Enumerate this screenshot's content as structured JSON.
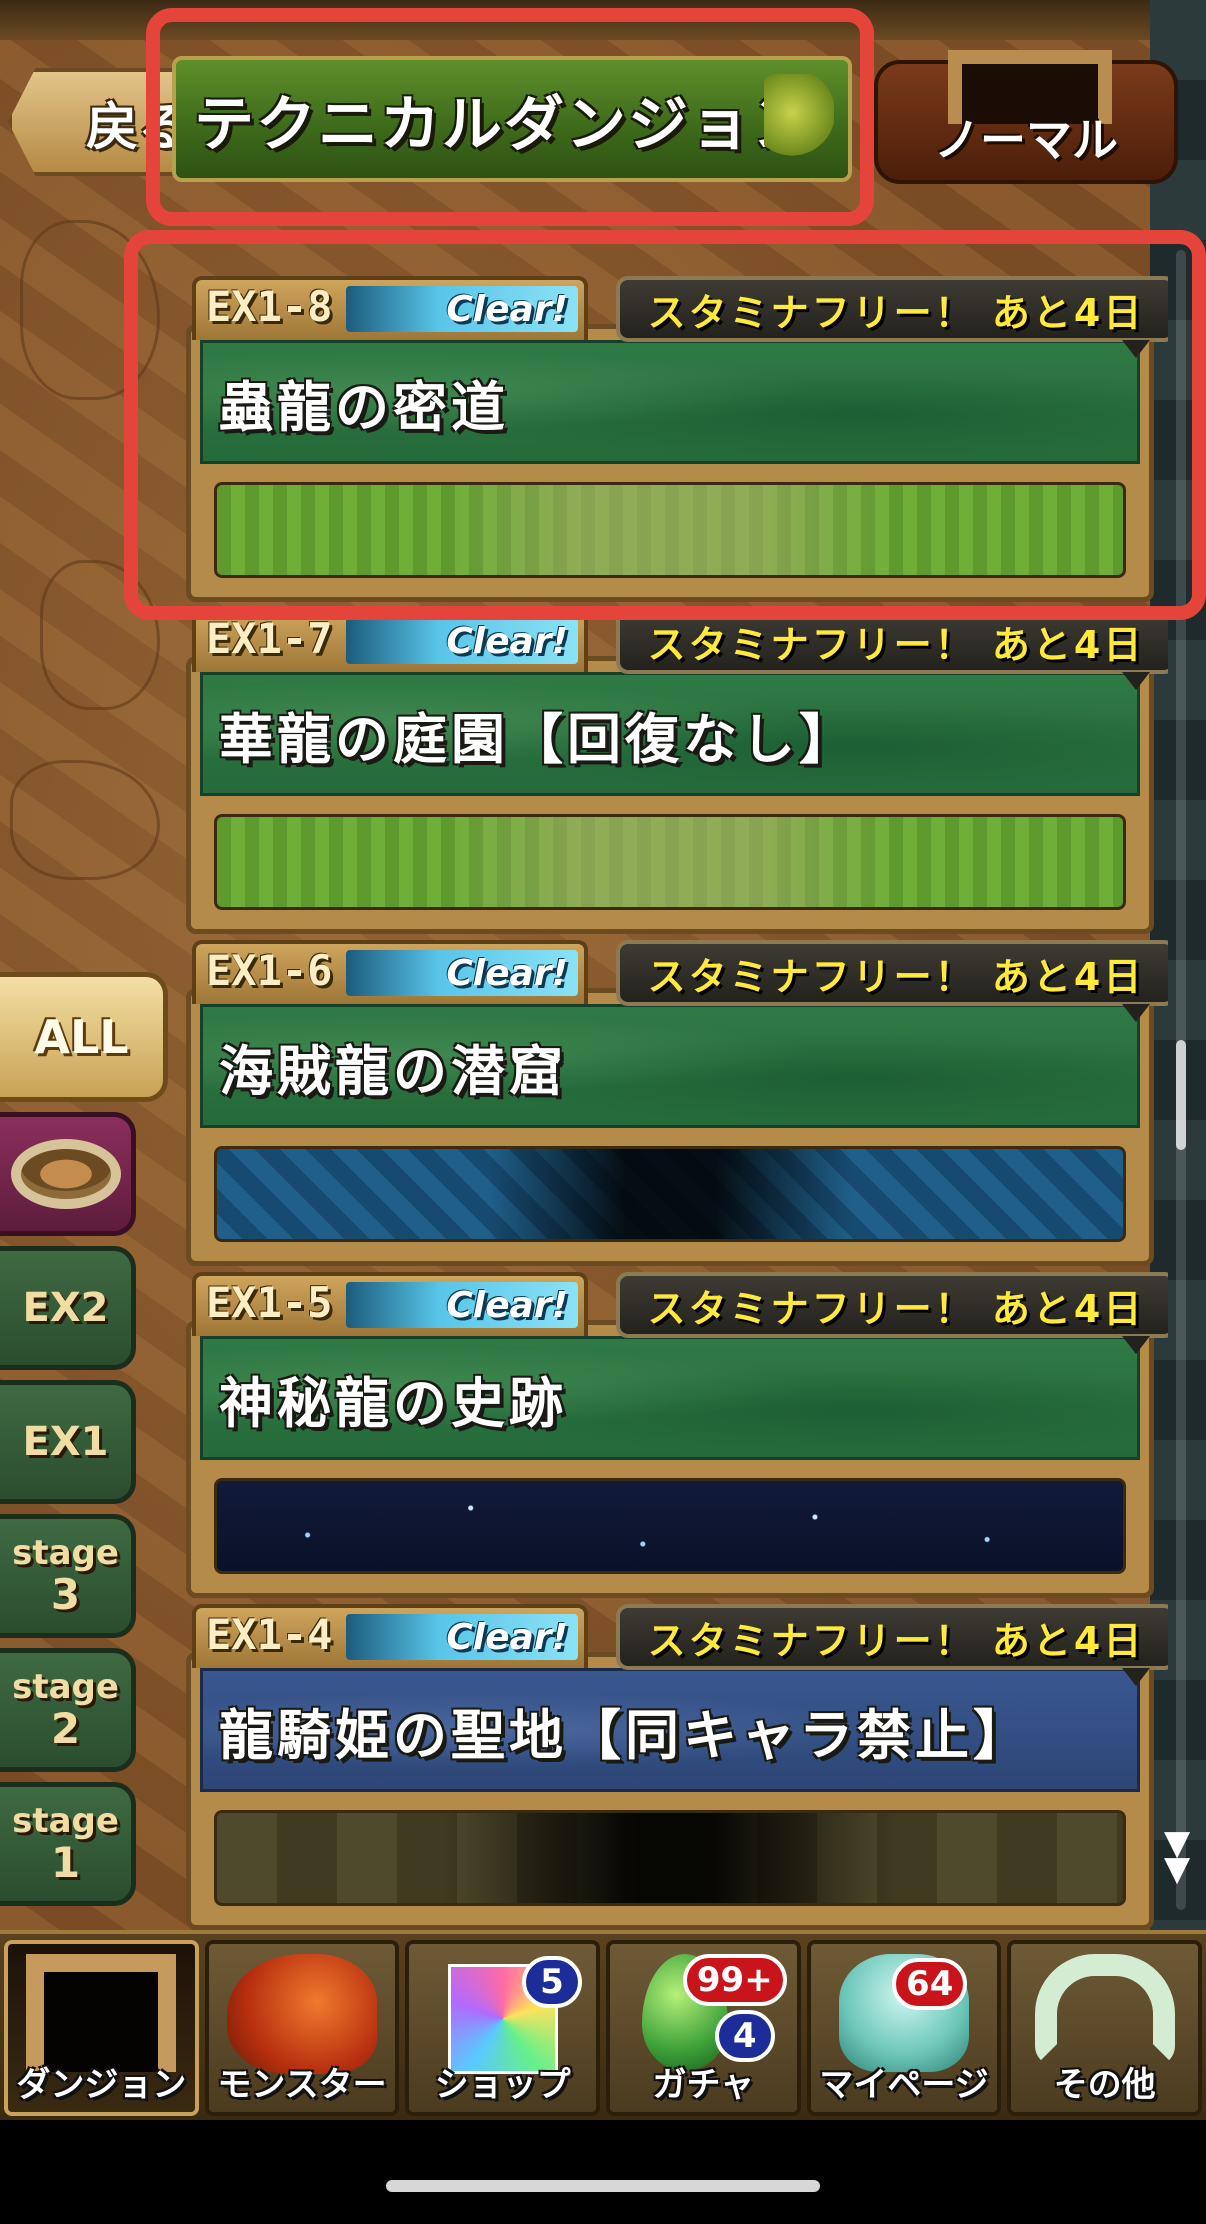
{
  "header": {
    "back_label": "戻る",
    "title": "テクニカルダンジョン",
    "difficulty": "ノーマル"
  },
  "side_filters": [
    {
      "label": "ALL",
      "kind": "all"
    },
    {
      "label": "",
      "kind": "arena"
    },
    {
      "label": "EX2",
      "kind": "plain"
    },
    {
      "label": "EX1",
      "kind": "plain"
    },
    {
      "label": "stage",
      "num": "3",
      "kind": "stage"
    },
    {
      "label": "stage",
      "num": "2",
      "kind": "stage"
    },
    {
      "label": "stage",
      "num": "1",
      "kind": "stage"
    }
  ],
  "dungeons": [
    {
      "code": "EX1-8",
      "status": "Clear!",
      "stamina": "スタミナフリー！ あと4日",
      "name": "蟲龍の密道",
      "banner": "grass",
      "panel": "green"
    },
    {
      "code": "EX1-7",
      "status": "Clear!",
      "stamina": "スタミナフリー！ あと4日",
      "name": "華龍の庭園【回復なし】",
      "banner": "grass",
      "panel": "green"
    },
    {
      "code": "EX1-6",
      "status": "Clear!",
      "stamina": "スタミナフリー！ あと4日",
      "name": "海賊龍の潜窟",
      "banner": "water",
      "panel": "green"
    },
    {
      "code": "EX1-5",
      "status": "Clear!",
      "stamina": "スタミナフリー！ あと4日",
      "name": "神秘龍の史跡",
      "banner": "space",
      "panel": "green"
    },
    {
      "code": "EX1-4",
      "status": "Clear!",
      "stamina": "スタミナフリー！ あと4日",
      "name": "龍騎姫の聖地【同キャラ禁止】",
      "banner": "dark",
      "panel": "blue"
    }
  ],
  "nav": [
    {
      "label": "ダンジョン",
      "icon": "dungeon-gate-icon"
    },
    {
      "label": "モンスター",
      "icon": "dragon-icon"
    },
    {
      "label": "ショップ",
      "icon": "gem-icon",
      "badge": "5"
    },
    {
      "label": "ガチャ",
      "icon": "egg-icon",
      "badge_top": "99+",
      "badge": "4"
    },
    {
      "label": "マイページ",
      "icon": "person-icon",
      "badge_top": "64"
    },
    {
      "label": "その他",
      "icon": "question-icon"
    }
  ],
  "colors": {
    "annotation": "#e5443b",
    "stamina_text": "#ffe93a",
    "clear_pill": "#58c5e9"
  }
}
